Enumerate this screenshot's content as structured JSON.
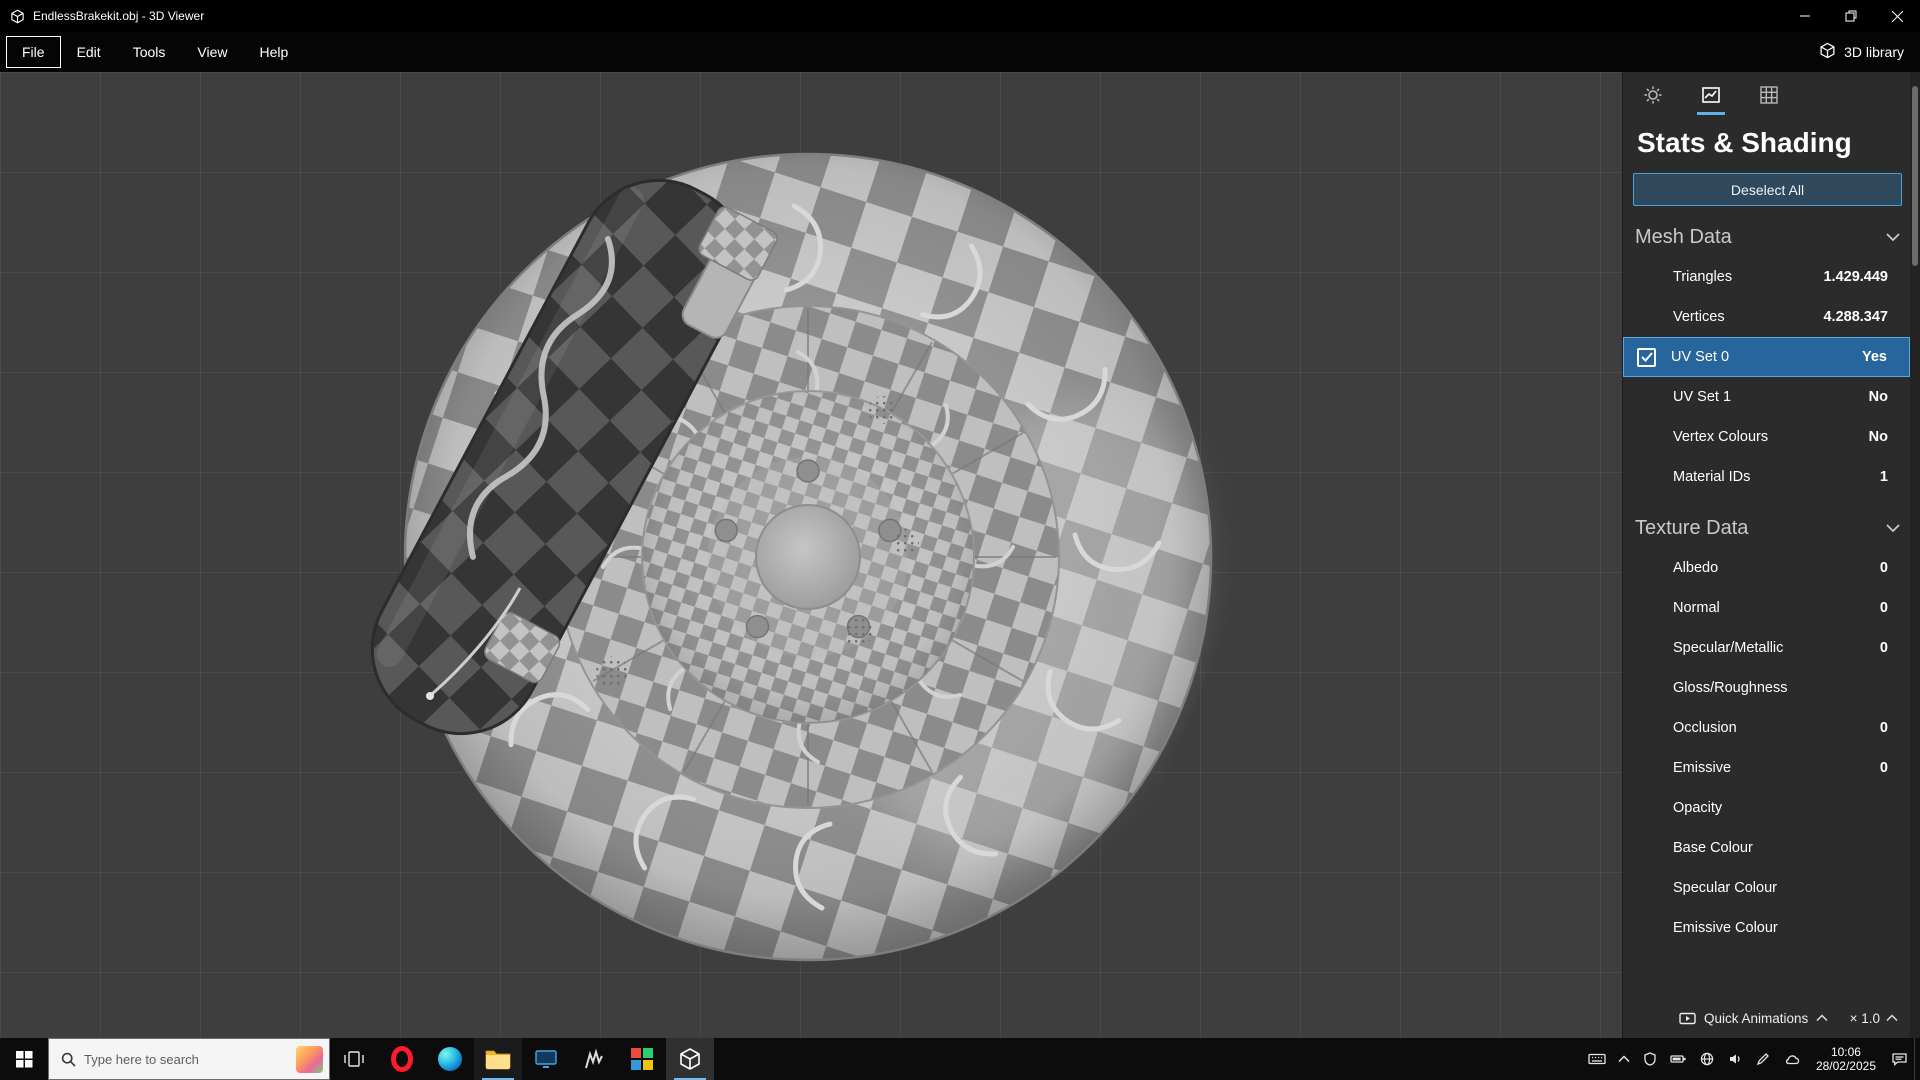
{
  "window": {
    "title": "EndlessBrakekit.obj - 3D Viewer"
  },
  "menu": {
    "items": [
      {
        "label": "File"
      },
      {
        "label": "Edit"
      },
      {
        "label": "Tools"
      },
      {
        "label": "View"
      },
      {
        "label": "Help"
      }
    ],
    "library_label": "3D library"
  },
  "panel": {
    "title": "Stats & Shading",
    "deselect_label": "Deselect All",
    "mesh": {
      "header": "Mesh Data",
      "rows": [
        {
          "label": "Triangles",
          "value": "1.429.449"
        },
        {
          "label": "Vertices",
          "value": "4.288.347"
        },
        {
          "label": "UV Set 0",
          "value": "Yes",
          "selected": true
        },
        {
          "label": "UV Set 1",
          "value": "No"
        },
        {
          "label": "Vertex Colours",
          "value": "No"
        },
        {
          "label": "Material IDs",
          "value": "1"
        }
      ]
    },
    "texture": {
      "header": "Texture Data",
      "rows": [
        {
          "label": "Albedo",
          "value": "0"
        },
        {
          "label": "Normal",
          "value": "0"
        },
        {
          "label": "Specular/Metallic",
          "value": "0"
        },
        {
          "label": "Gloss/Roughness",
          "value": ""
        },
        {
          "label": "Occlusion",
          "value": "0"
        },
        {
          "label": "Emissive",
          "value": "0"
        },
        {
          "label": "Opacity",
          "value": ""
        },
        {
          "label": "Base Colour",
          "value": ""
        },
        {
          "label": "Specular Colour",
          "value": ""
        },
        {
          "label": "Emissive Colour",
          "value": ""
        }
      ]
    },
    "footer": {
      "animations_label": "Quick Animations",
      "speed_label": "× 1.0"
    }
  },
  "taskbar": {
    "search_placeholder": "Type here to search",
    "clock": {
      "time": "10:06",
      "date": "28/02/2025"
    }
  },
  "colors": {
    "accent_blue": "#4a9ede",
    "selection_bg": "#27669c",
    "tab_underline": "#5fb2e8"
  }
}
